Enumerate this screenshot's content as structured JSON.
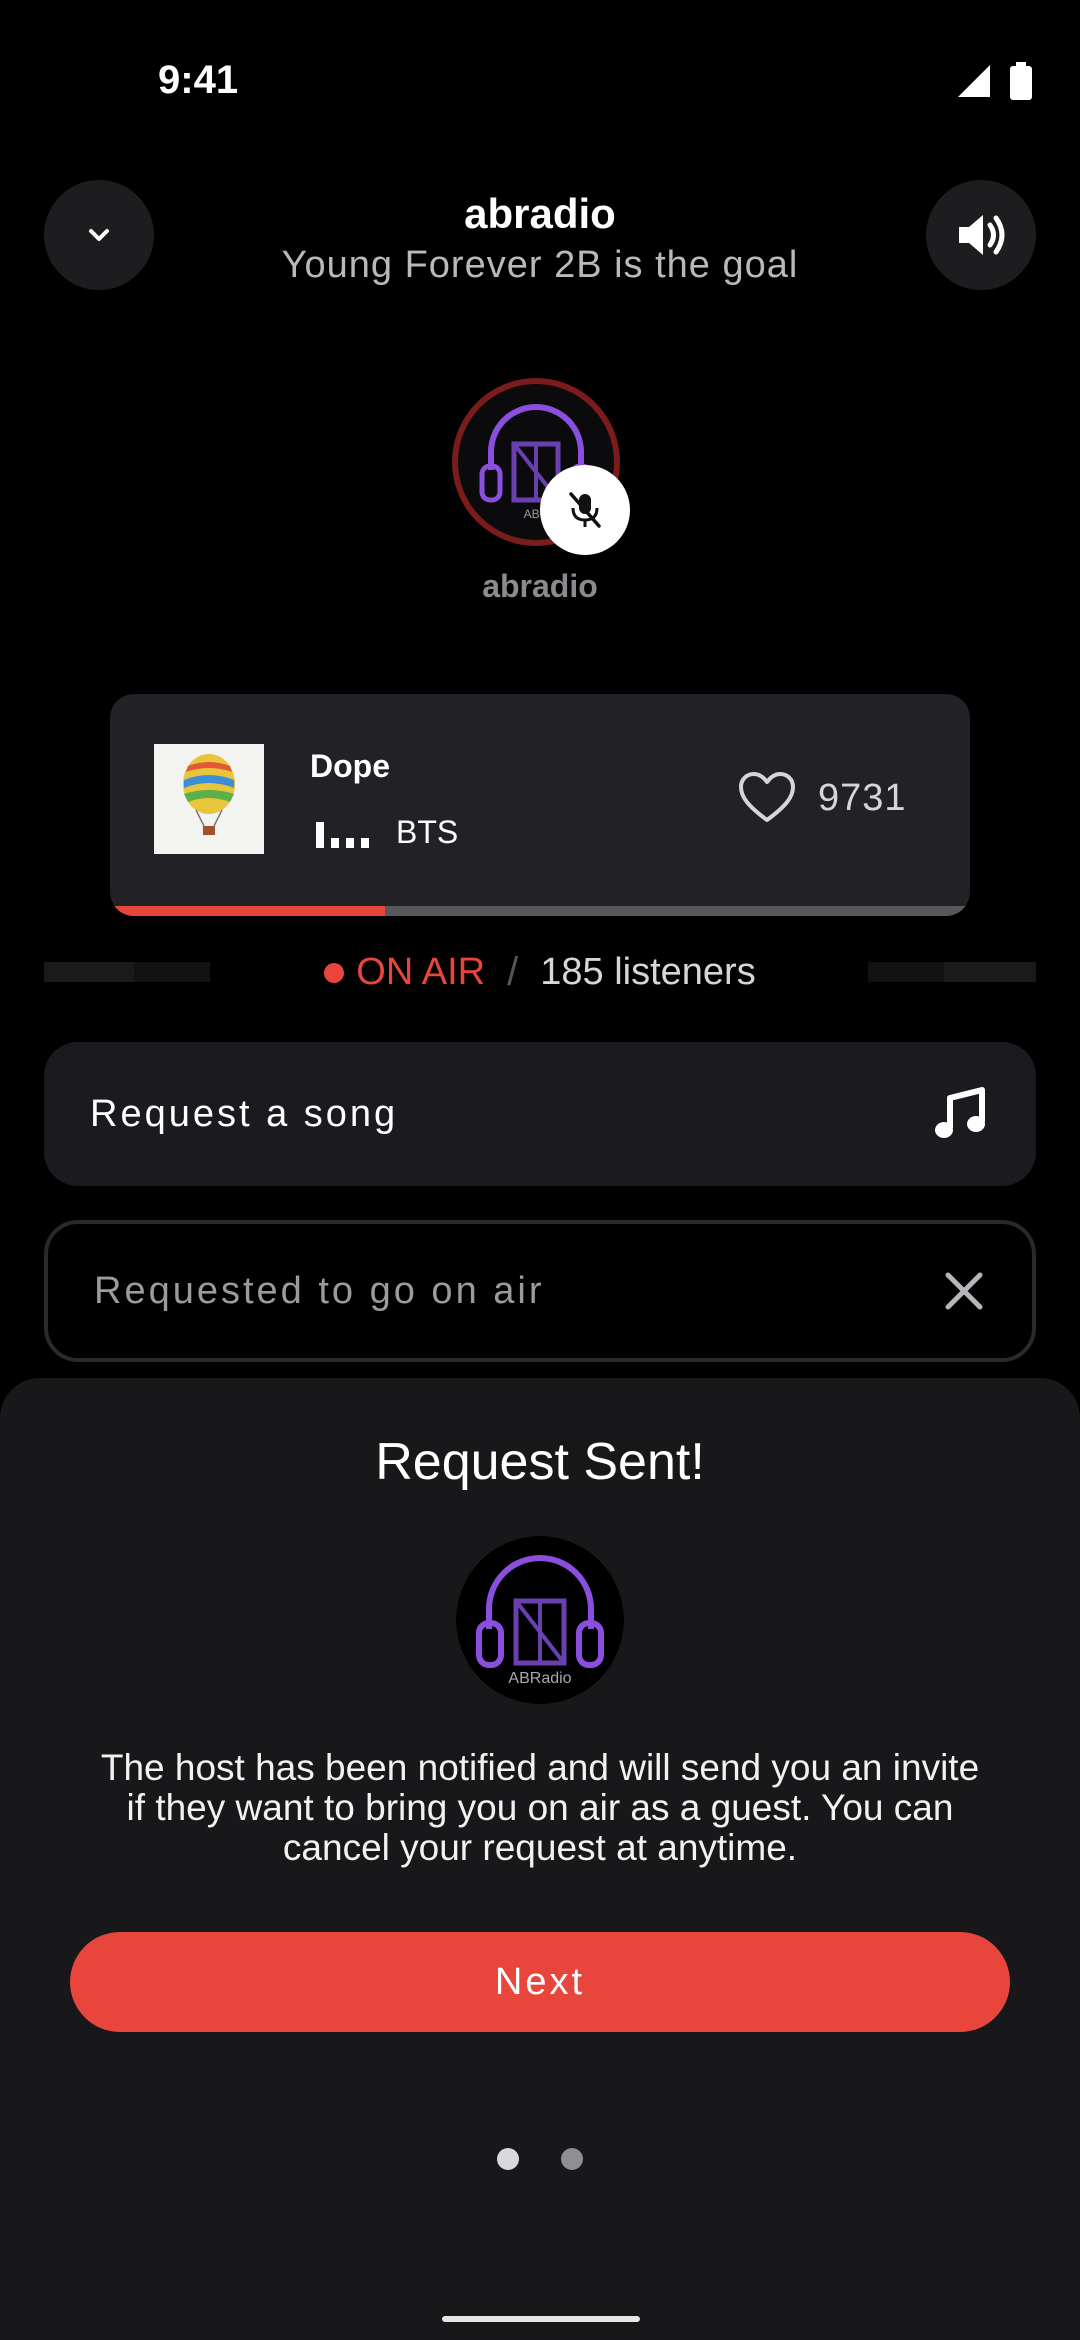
{
  "status_bar": {
    "time": "9:41"
  },
  "header": {
    "title": "abradio",
    "subtitle": "Young Forever 2B  is the goal"
  },
  "host": {
    "name": "abradio",
    "logo_text": "ABR"
  },
  "now_playing": {
    "title": "Dope",
    "artist": "BTS",
    "likes": "9731",
    "progress_fraction": 0.32
  },
  "broadcast": {
    "status": "ON AIR",
    "separator": "/",
    "listeners": "185 listeners"
  },
  "actions": {
    "request_song": "Request a song",
    "requested_on_air": "Requested to go on air"
  },
  "sheet": {
    "title": "Request Sent!",
    "logo_text": "ABRadio",
    "message": "The host has been notified and will send you an invite if they want to bring you on air as a guest. You can cancel your request at anytime.",
    "next_label": "Next",
    "page_count": 2,
    "active_page": 0
  },
  "colors": {
    "accent_red": "#e8453c",
    "logo_purple": "#8b4fe0",
    "surface": "#222226",
    "sheet": "#18181b"
  }
}
